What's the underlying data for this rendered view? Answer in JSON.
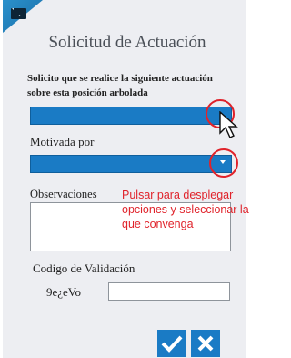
{
  "header": {
    "title": "Solicitud de Actuación",
    "icon": "mail-icon"
  },
  "form": {
    "request_label": "Solicito que se realice la siguiente actuación sobre esta posición arbolada",
    "request_select_value": "",
    "reason_label": "Motivada por",
    "reason_select_value": "",
    "observations_label": "Observaciones",
    "observations_value": "",
    "validation_label": "Codigo de Validación",
    "captcha_text": "9e¿eVo",
    "validation_input_value": ""
  },
  "annotation": {
    "note": "Pulsar para desplegar opciones y seleccionar la que convenga",
    "color": "#e0232b"
  },
  "actions": {
    "confirm_icon": "check-icon",
    "cancel_icon": "close-icon"
  },
  "colors": {
    "accent": "#1a7bc5",
    "panel": "#edeef2"
  }
}
